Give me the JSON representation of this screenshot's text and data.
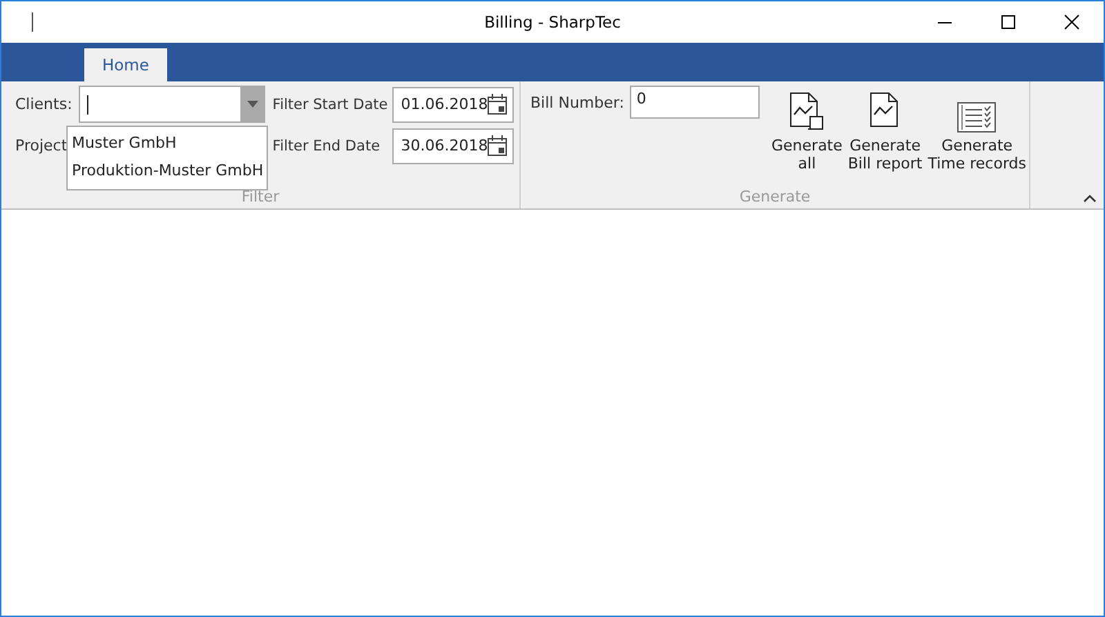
{
  "window": {
    "title": "Billing - SharpTec"
  },
  "tabs": [
    {
      "label": "Home",
      "selected": true
    }
  ],
  "filter": {
    "label": "Filter",
    "clients": {
      "label": "Clients:",
      "expanded": true,
      "options": [
        "Muster GmbH",
        "Produktion-Muster GmbH"
      ]
    },
    "projects": {
      "label": "Project"
    },
    "start_date": {
      "label": "Filter Start Date",
      "value": "01.06.2018"
    },
    "end_date": {
      "label": "Filter End Date",
      "value": "30.06.2018"
    }
  },
  "generate": {
    "label": "Generate",
    "bill_number": {
      "label": "Bill Number:",
      "value": "0"
    },
    "buttons": [
      {
        "kind": "all",
        "label": "Generate\nall"
      },
      {
        "kind": "report",
        "label": "Generate\nBill report"
      },
      {
        "kind": "time",
        "label": "Generate\nTime records"
      }
    ]
  }
}
